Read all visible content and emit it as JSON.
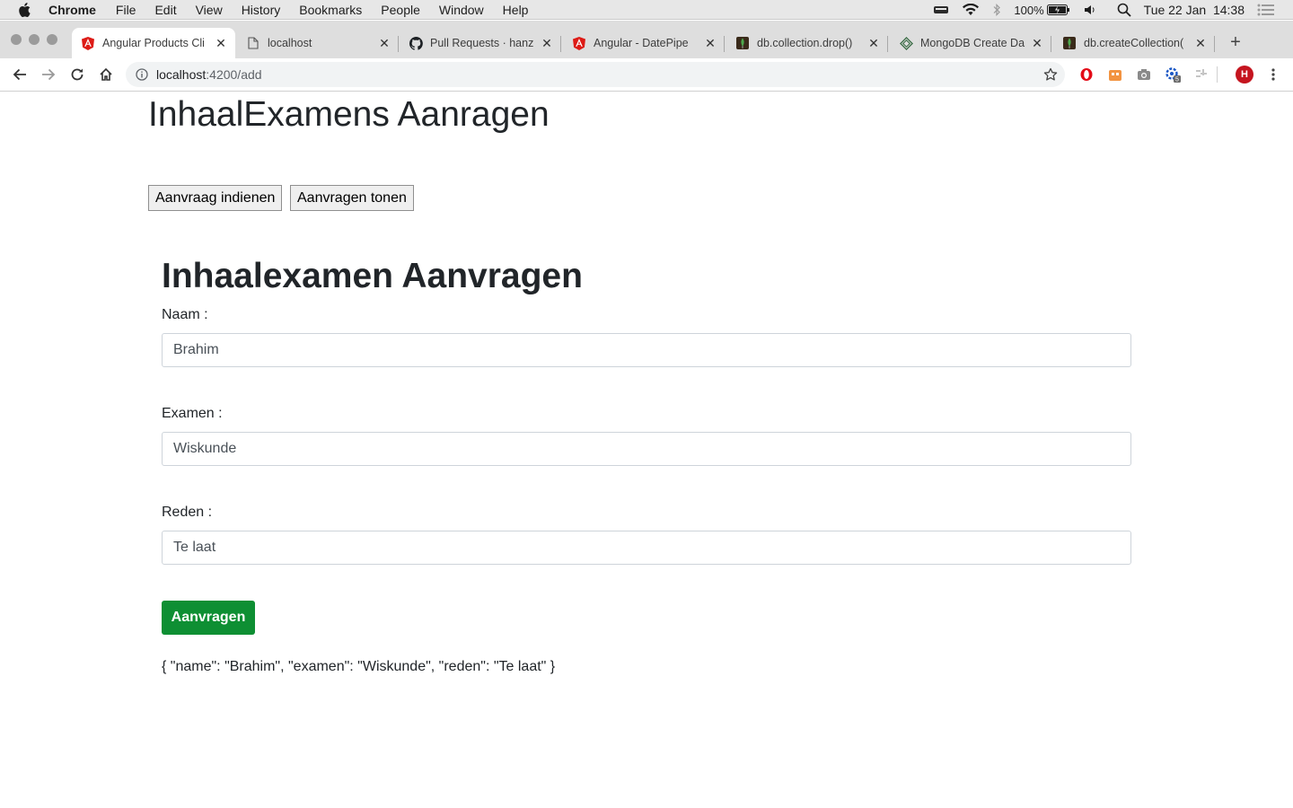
{
  "menubar": {
    "app_name": "Chrome",
    "items": [
      "File",
      "Edit",
      "View",
      "History",
      "Bookmarks",
      "People",
      "Window",
      "Help"
    ],
    "battery": "100%",
    "datetime": "Tue 22 Jan  14:38"
  },
  "tabs": [
    {
      "title": "Angular Products Cli",
      "icon": "angular-icon",
      "active": true
    },
    {
      "title": "localhost",
      "icon": "page-icon",
      "active": false
    },
    {
      "title": "Pull Requests · hanz",
      "icon": "github-icon",
      "active": false
    },
    {
      "title": "Angular - DatePipe",
      "icon": "angular-icon",
      "active": false
    },
    {
      "title": "db.collection.drop()",
      "icon": "mongodb-leaf-icon",
      "active": false
    },
    {
      "title": "MongoDB Create Da",
      "icon": "diamond-icon",
      "active": false
    },
    {
      "title": "db.createCollection(",
      "icon": "mongodb-leaf-icon",
      "active": false
    }
  ],
  "address": {
    "host": "localhost",
    "path": ":4200/add"
  },
  "extensions": {
    "badge_count": "5",
    "profile_initial": "H"
  },
  "page": {
    "app_title": "InhaalExamens Aanragen",
    "nav": {
      "submit_request": "Aanvraag indienen",
      "show_requests": "Aanvragen tonen"
    },
    "form": {
      "title": "Inhaalexamen Aanvragen",
      "name_label": "Naam :",
      "name_value": "Brahim",
      "exam_label": "Examen :",
      "exam_value": "Wiskunde",
      "reason_label": "Reden :",
      "reason_value": "Te laat",
      "submit_label": "Aanvragen"
    },
    "json_output": "{ \"name\": \"Brahim\", \"examen\": \"Wiskunde\", \"reden\": \"Te laat\" }"
  }
}
